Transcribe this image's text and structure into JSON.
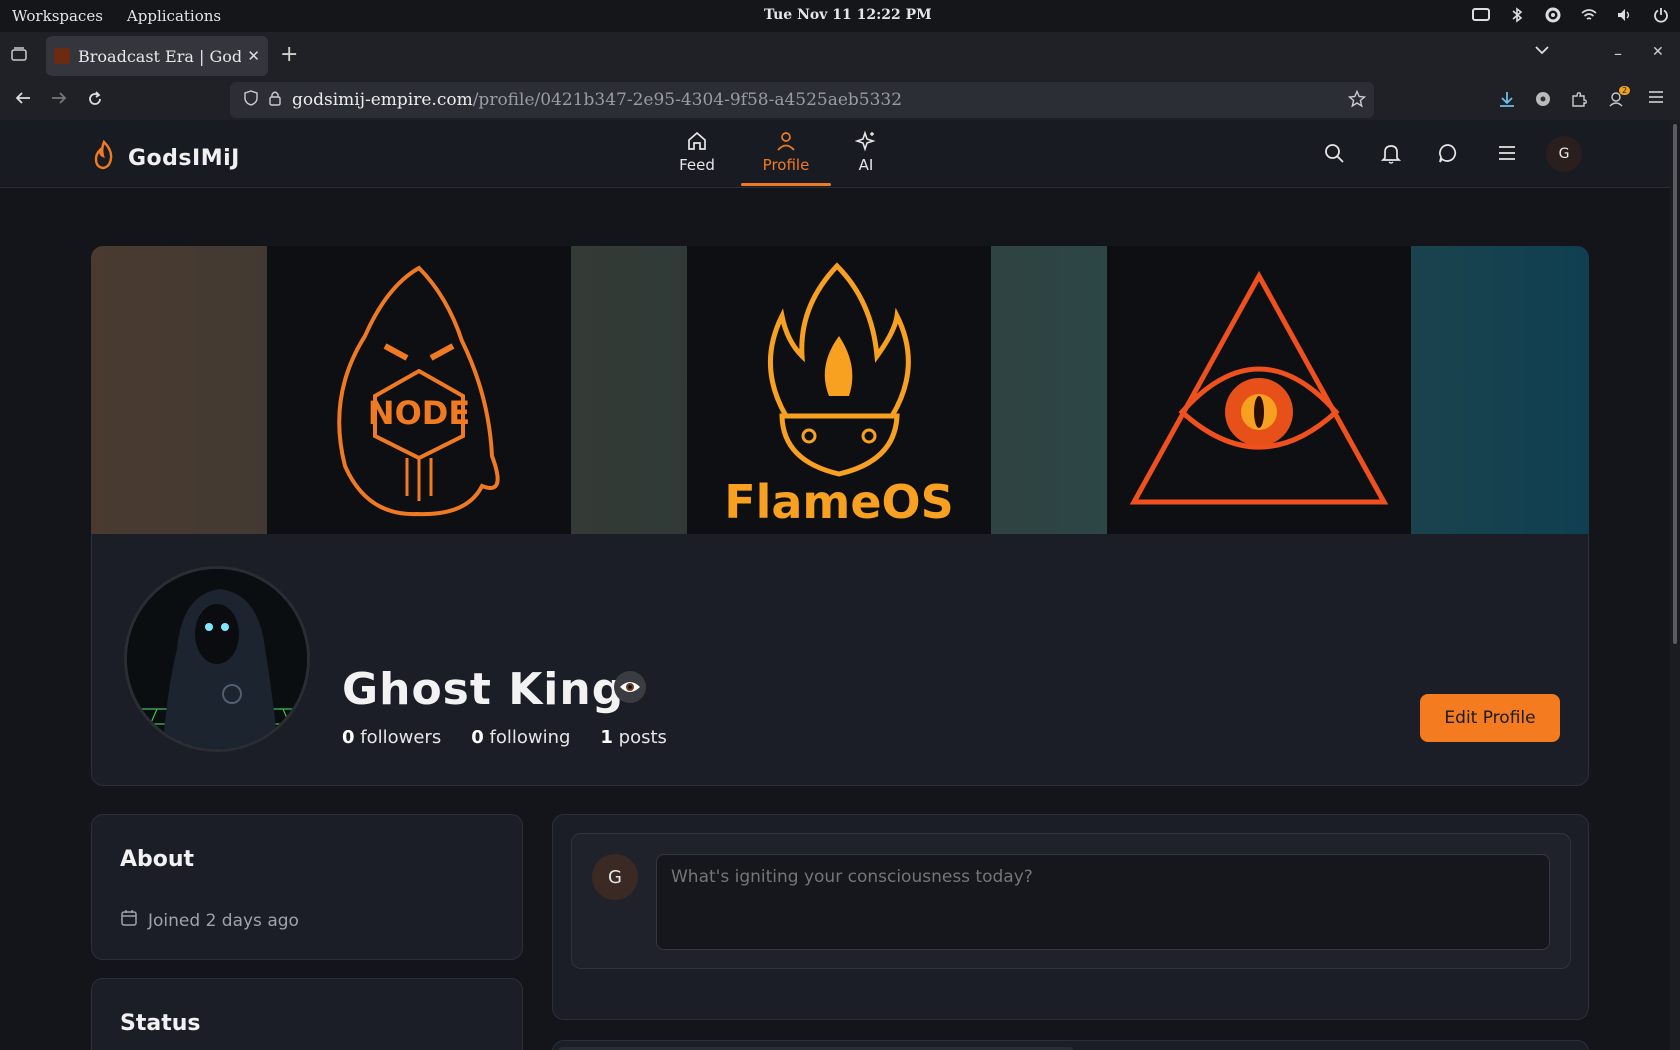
{
  "desktop": {
    "menu": [
      "Workspaces",
      "Applications"
    ],
    "clock": "Tue Nov 11  12:22 PM"
  },
  "browser": {
    "tab_title": "Broadcast Era | GodsIMiJ",
    "url_host": "godsimij-empire.com",
    "url_path": "/profile/0421b347-2e95-4304-9f58-a4525aeb5332",
    "download_badge": "2"
  },
  "app": {
    "brand": "GodsIMiJ",
    "nav": [
      {
        "label": "Feed",
        "icon": "home-icon",
        "active": false
      },
      {
        "label": "Profile",
        "icon": "user-icon",
        "active": true
      },
      {
        "label": "AI",
        "icon": "sparkles-icon",
        "active": false
      }
    ],
    "user_initial": "G",
    "accent": "#f07a22"
  },
  "banner": {
    "tiles": [
      "NODE",
      "FlameOS",
      "eye-of-providence"
    ]
  },
  "profile": {
    "name": "Ghost King",
    "followers_count": "0",
    "followers_label": "followers",
    "following_count": "0",
    "following_label": "following",
    "posts_count": "1",
    "posts_label": "posts",
    "edit_label": "Edit Profile"
  },
  "about": {
    "title": "About",
    "joined": "Joined 2 days ago"
  },
  "status": {
    "title": "Status"
  },
  "composer": {
    "initial": "G",
    "placeholder": "What's igniting your consciousness today?"
  }
}
